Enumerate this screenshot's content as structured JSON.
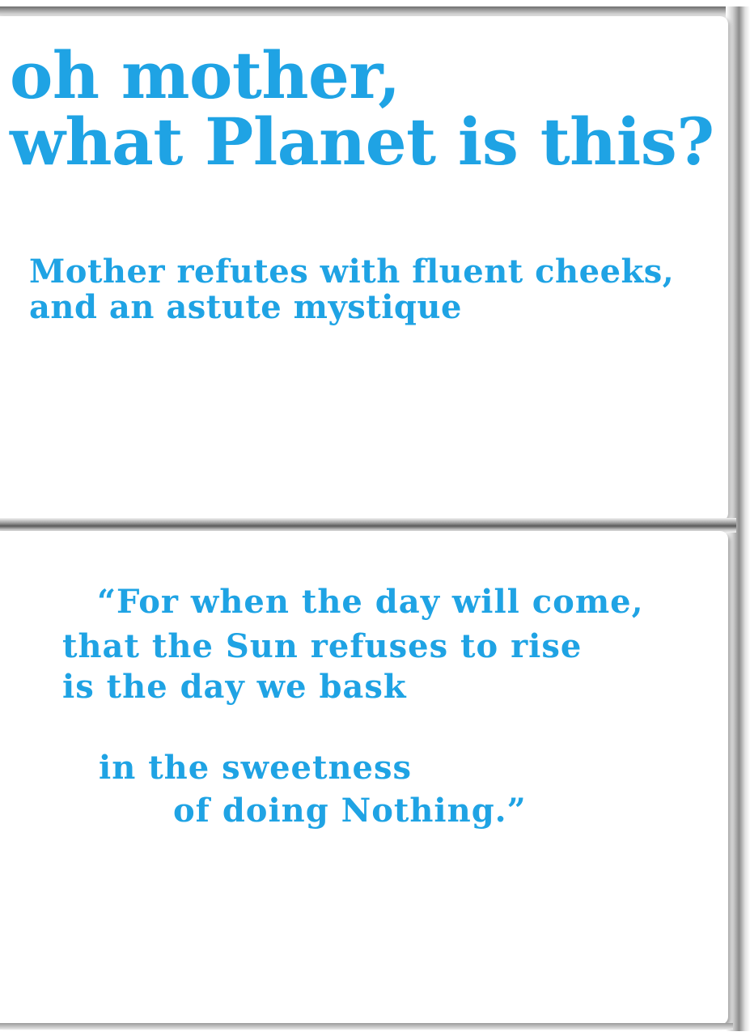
{
  "heading": {
    "line1": "oh mother,",
    "line2": "what Planet is this?"
  },
  "subheading": {
    "line1": "Mother refutes with fluent cheeks,",
    "line2": "and an astute mystique"
  },
  "quote": {
    "line1": "“For when the day will come,",
    "line2": "that the Sun refuses to rise",
    "line3": "is the day we bask",
    "line4": "in the sweetness",
    "line5": "of doing Nothing.”"
  },
  "colors": {
    "text": "#1fa3e4",
    "paper": "#ffffff"
  }
}
